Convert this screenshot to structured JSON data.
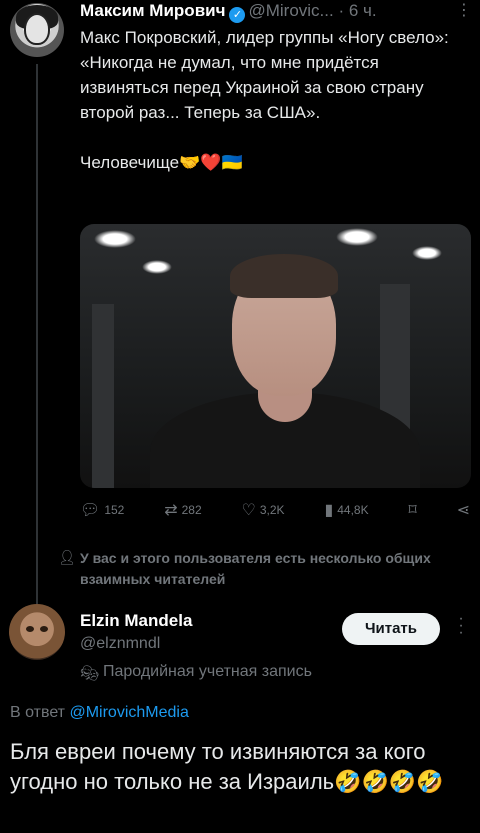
{
  "tweet": {
    "author_name": "Максим Мирович",
    "author_handle": "@Mirovic...",
    "time": "· 6 ч.",
    "text": "Макс Покровский, лидер группы «Ногу свело»:\n«Никогда не думал, что мне придётся извиняться перед Украиной за свою страну второй раз... Теперь за США».\n\nЧеловечище🤝❤️🇺🇦",
    "stats": {
      "replies": "152",
      "reposts": "282",
      "likes": "3,2K",
      "views": "44,8K"
    }
  },
  "mutual_notice": "У вас и этого пользователя есть несколько общих взаимных читателей",
  "reply": {
    "author_name": "Elzin Mandela",
    "author_handle": "@elznmndl",
    "follow_label": "Читать",
    "parody_label": "Пародийная учетная запись",
    "reply_to_prefix": "В ответ",
    "reply_to_handle": "@MirovichMedia",
    "text": "Бля евреи почему то извиняются за кого угодно но только не за Израиль🤣🤣🤣🤣"
  },
  "colors": {
    "background": "#000000",
    "text": "#e7e9ea",
    "muted": "#71767b",
    "accent": "#1d9bf0"
  },
  "icons": [
    "verified-icon",
    "more-icon",
    "reply-icon",
    "repost-icon",
    "like-icon",
    "views-icon",
    "bookmark-icon",
    "share-icon",
    "user-icon",
    "parody-mask-icon"
  ]
}
